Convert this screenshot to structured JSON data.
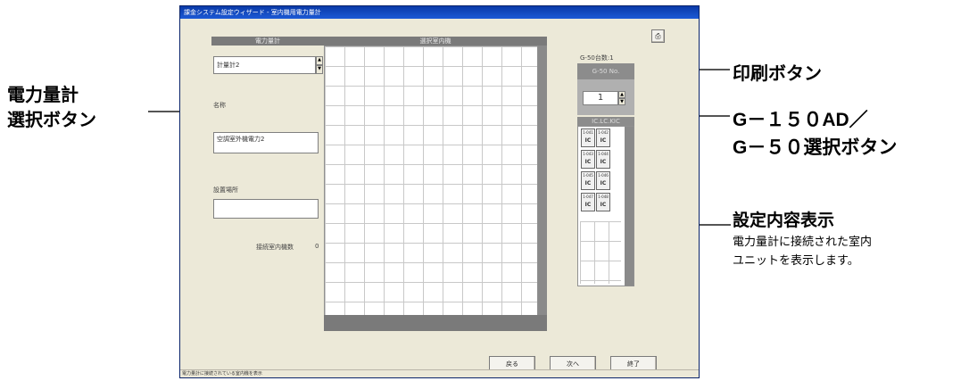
{
  "window": {
    "title": "課金システム設定ウィザード - 室内機用電力量計",
    "status_text": "電力量計に接続されている室内機を表示"
  },
  "meter_panel": {
    "header": "電力量計",
    "selected_meter": "計量計2",
    "name_label": "名称",
    "name_value": "空調室外機電力2",
    "location_label": "設置場所",
    "location_value": "",
    "connected_label": "接続室内機数",
    "connected_count": "0"
  },
  "unit_panel": {
    "header": "選択室内機"
  },
  "g50_panel": {
    "count_label": "G-50台数:1",
    "no_label": "G-50 No.",
    "no_value": "1",
    "ic_header": "IC.LC.KIC",
    "cells": [
      {
        "addr": "1-041",
        "type": "IC"
      },
      {
        "addr": "1-042",
        "type": "IC"
      },
      {
        "addr": "1-043",
        "type": "IC"
      },
      {
        "addr": "1-044",
        "type": "IC"
      },
      {
        "addr": "1-045",
        "type": "IC"
      },
      {
        "addr": "1-046",
        "type": "IC"
      },
      {
        "addr": "1-047",
        "type": "IC"
      },
      {
        "addr": "1-048",
        "type": "IC"
      }
    ]
  },
  "buttons": {
    "back": "戻る",
    "next": "次へ",
    "finish": "終了"
  },
  "callouts": {
    "meter_select_line1": "電力量計",
    "meter_select_line2": "選択ボタン",
    "print": "印刷ボタン",
    "g50_line1": "G－１５０AD／",
    "g50_line2": "G－５０選択ボタン",
    "display_title": "設定内容表示",
    "display_desc_line1": "電力量計に接続された室内",
    "display_desc_line2": "ユニットを表示します。"
  }
}
